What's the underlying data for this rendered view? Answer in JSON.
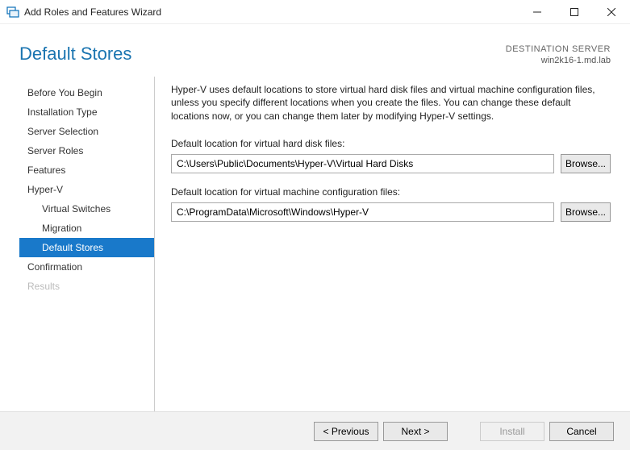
{
  "window": {
    "title": "Add Roles and Features Wizard"
  },
  "header": {
    "page_title": "Default Stores",
    "destination_label": "DESTINATION SERVER",
    "destination_value": "win2k16-1.md.lab"
  },
  "sidebar": {
    "items": [
      {
        "label": "Before You Begin",
        "sub": false,
        "selected": false,
        "disabled": false
      },
      {
        "label": "Installation Type",
        "sub": false,
        "selected": false,
        "disabled": false
      },
      {
        "label": "Server Selection",
        "sub": false,
        "selected": false,
        "disabled": false
      },
      {
        "label": "Server Roles",
        "sub": false,
        "selected": false,
        "disabled": false
      },
      {
        "label": "Features",
        "sub": false,
        "selected": false,
        "disabled": false
      },
      {
        "label": "Hyper-V",
        "sub": false,
        "selected": false,
        "disabled": false
      },
      {
        "label": "Virtual Switches",
        "sub": true,
        "selected": false,
        "disabled": false
      },
      {
        "label": "Migration",
        "sub": true,
        "selected": false,
        "disabled": false
      },
      {
        "label": "Default Stores",
        "sub": true,
        "selected": true,
        "disabled": false
      },
      {
        "label": "Confirmation",
        "sub": false,
        "selected": false,
        "disabled": false
      },
      {
        "label": "Results",
        "sub": false,
        "selected": false,
        "disabled": true
      }
    ]
  },
  "content": {
    "intro": "Hyper-V uses default locations to store virtual hard disk files and virtual machine configuration files, unless you specify different locations when you create the files. You can change these default locations now, or you can change them later by modifying Hyper-V settings.",
    "vhd_label": "Default location for virtual hard disk files:",
    "vhd_value": "C:\\Users\\Public\\Documents\\Hyper-V\\Virtual Hard Disks",
    "vm_label": "Default location for virtual machine configuration files:",
    "vm_value": "C:\\ProgramData\\Microsoft\\Windows\\Hyper-V",
    "browse_label": "Browse..."
  },
  "footer": {
    "previous": "< Previous",
    "next": "Next >",
    "install": "Install",
    "cancel": "Cancel"
  }
}
